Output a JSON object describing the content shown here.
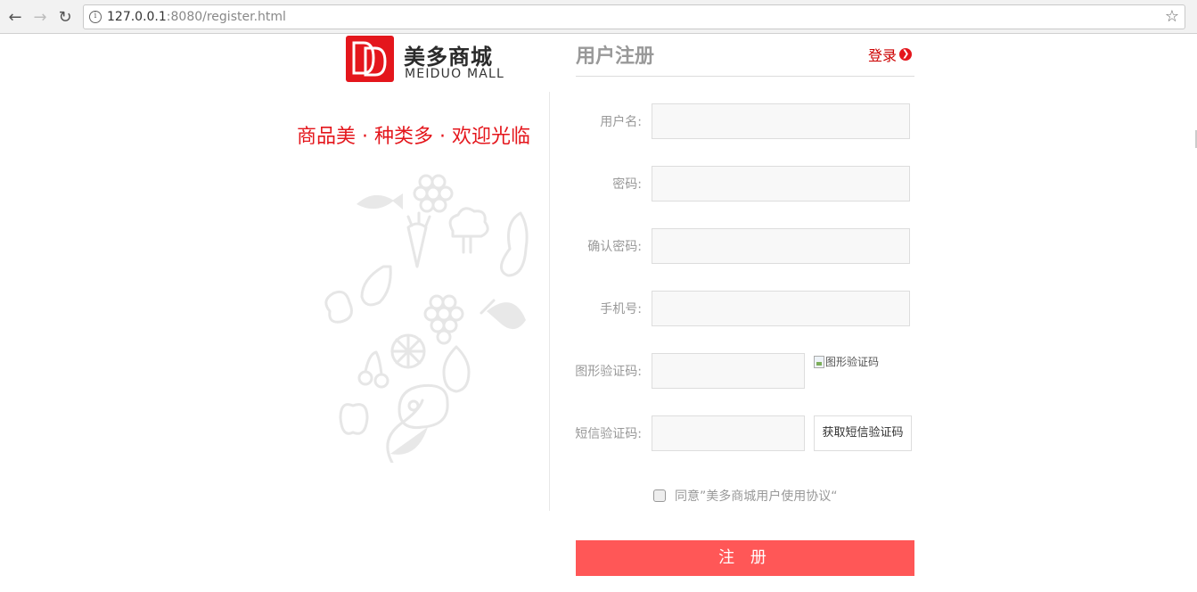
{
  "browser": {
    "url_host": "127.0.0.1",
    "url_rest": ":8080/register.html"
  },
  "brand": {
    "name_cn": "美多商城",
    "name_en": "MEIDUO MALL",
    "accent": "#e4161c",
    "slogan": "商品美 · 种类多 · 欢迎光临"
  },
  "form": {
    "title": "用户注册",
    "login_link": "登录",
    "fields": {
      "username": {
        "label": "用户名:",
        "value": ""
      },
      "password": {
        "label": "密码:",
        "value": ""
      },
      "password_confirm": {
        "label": "确认密码:",
        "value": ""
      },
      "mobile": {
        "label": "手机号:",
        "value": ""
      },
      "image_code": {
        "label": "图形验证码:",
        "value": "",
        "image_alt": "图形验证码"
      },
      "sms_code": {
        "label": "短信验证码:",
        "value": "",
        "button": "获取短信验证码"
      }
    },
    "agreement": "同意”美多商城用户使用协议“",
    "agreement_checked": false,
    "submit": "注 册",
    "submit_color": "#ff5757"
  },
  "icons": [
    "back-arrow-icon",
    "forward-arrow-icon",
    "reload-icon",
    "info-icon",
    "bookmark-star-icon",
    "arrow-right-circle-icon",
    "broken-image-icon"
  ]
}
